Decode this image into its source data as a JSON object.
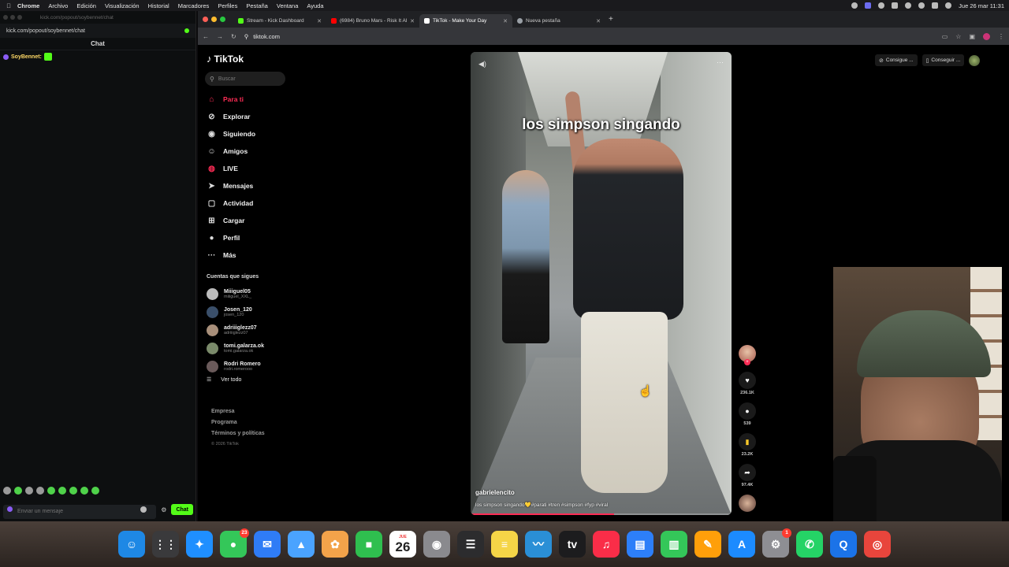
{
  "menubar": {
    "app": "Chrome",
    "items": [
      "Archivo",
      "Edición",
      "Visualización",
      "Historial",
      "Marcadores",
      "Perfiles",
      "Pestaña",
      "Ventana",
      "Ayuda"
    ],
    "datetime": "Jue 26 mar 11:31"
  },
  "kick": {
    "window_title": "kick.com/popout/soybennet/chat",
    "url": "kick.com/popout/soybennet/chat",
    "chat_header": "Chat",
    "message_user": "SoyBennet:",
    "input_placeholder": "Enviar un mensaje",
    "chat_button": "Chat"
  },
  "chrome": {
    "tabs": [
      {
        "label": "Stream - Kick Dashboard",
        "color": "#53fc18"
      },
      {
        "label": "(6984) Bruno Mars - Risk It All",
        "color": "#ff0000"
      },
      {
        "label": "TikTok - Make Your Day",
        "color": "#ffffff"
      },
      {
        "label": "Nueva pestaña",
        "color": "#9aa0a6"
      }
    ],
    "address": "tiktok.com"
  },
  "tiktok": {
    "logo": "TikTok",
    "search_placeholder": "Buscar",
    "nav": [
      {
        "label": "Para ti",
        "icon": "home-icon",
        "active": true
      },
      {
        "label": "Explorar",
        "icon": "compass-icon"
      },
      {
        "label": "Siguiendo",
        "icon": "following-icon"
      },
      {
        "label": "Amigos",
        "icon": "friends-icon"
      },
      {
        "label": "LIVE",
        "icon": "live-icon"
      },
      {
        "label": "Mensajes",
        "icon": "messages-icon"
      },
      {
        "label": "Actividad",
        "icon": "activity-icon"
      },
      {
        "label": "Cargar",
        "icon": "upload-icon"
      },
      {
        "label": "Perfil",
        "icon": "profile-icon"
      },
      {
        "label": "Más",
        "icon": "more-icon"
      }
    ],
    "following_title": "Cuentas que sigues",
    "following": [
      {
        "name": "Miiiguel05",
        "handle": "miiiguel_XXL_"
      },
      {
        "name": "Josen_120",
        "handle": "josen_120"
      },
      {
        "name": "adriiiglezz07",
        "handle": "adriiiglezz07"
      },
      {
        "name": "tomi.galarza.ok",
        "handle": "tomi.galarza.ok"
      },
      {
        "name": "Rodri Romero",
        "handle": "rodri.romerooo"
      }
    ],
    "see_all": "Ver todo",
    "footer": [
      "Empresa",
      "Programa",
      "Términos y políticas"
    ],
    "copyright": "© 2026 TikTok",
    "video": {
      "overlay_text": "los simpson singando",
      "author": "gabrielencito",
      "description": "los simpson singando💛#parati #tren #simpson #fyp #viral",
      "progress": 0.55
    },
    "actions": {
      "likes": "236.1K",
      "comments": "539",
      "saves": "23.2K",
      "shares": "97.4K"
    },
    "top_right": {
      "btn1": "Consigue ...",
      "btn2": "Conseguir ..."
    }
  },
  "dock": {
    "apps": [
      {
        "name": "finder",
        "color": "#1e88e5",
        "glyph": "☺"
      },
      {
        "name": "launchpad",
        "color": "#3a3a3c",
        "glyph": "⋮⋮"
      },
      {
        "name": "safari",
        "color": "#1f8fff",
        "glyph": "✦"
      },
      {
        "name": "messages",
        "color": "#34c759",
        "glyph": "●",
        "badge": "23"
      },
      {
        "name": "mail",
        "color": "#2f7cf6",
        "glyph": "✉"
      },
      {
        "name": "maps",
        "color": "#4aa3ff",
        "glyph": "▲"
      },
      {
        "name": "photos",
        "color": "#f3a34a",
        "glyph": "✿"
      },
      {
        "name": "facetime",
        "color": "#2fbf4f",
        "glyph": "■"
      },
      {
        "name": "calendar",
        "day": "26",
        "month": "JUE"
      },
      {
        "name": "contacts",
        "color": "#8a8a8e",
        "glyph": "◉"
      },
      {
        "name": "reminders",
        "color": "#2c2c2e",
        "glyph": "☰"
      },
      {
        "name": "notes",
        "color": "#f5d547",
        "glyph": "≡"
      },
      {
        "name": "freeform",
        "color": "#2a8fd6",
        "glyph": "〰"
      },
      {
        "name": "appletv",
        "color": "#1c1c1e",
        "glyph": "tv"
      },
      {
        "name": "music",
        "color": "#fa2d48",
        "glyph": "♫"
      },
      {
        "name": "keynote",
        "color": "#2d7ff9",
        "glyph": "▤"
      },
      {
        "name": "numbers",
        "color": "#34c759",
        "glyph": "▥"
      },
      {
        "name": "pages",
        "color": "#ff9f0a",
        "glyph": "✎"
      },
      {
        "name": "appstore",
        "color": "#1c8bff",
        "glyph": "A"
      },
      {
        "name": "settings",
        "color": "#8e8e93",
        "glyph": "⚙",
        "badge": "1"
      },
      {
        "name": "whatsapp",
        "color": "#25d366",
        "glyph": "✆"
      },
      {
        "name": "quicktime",
        "color": "#1b73e8",
        "glyph": "Q"
      },
      {
        "name": "chrome",
        "color": "#e8453c",
        "glyph": "◎"
      }
    ]
  }
}
